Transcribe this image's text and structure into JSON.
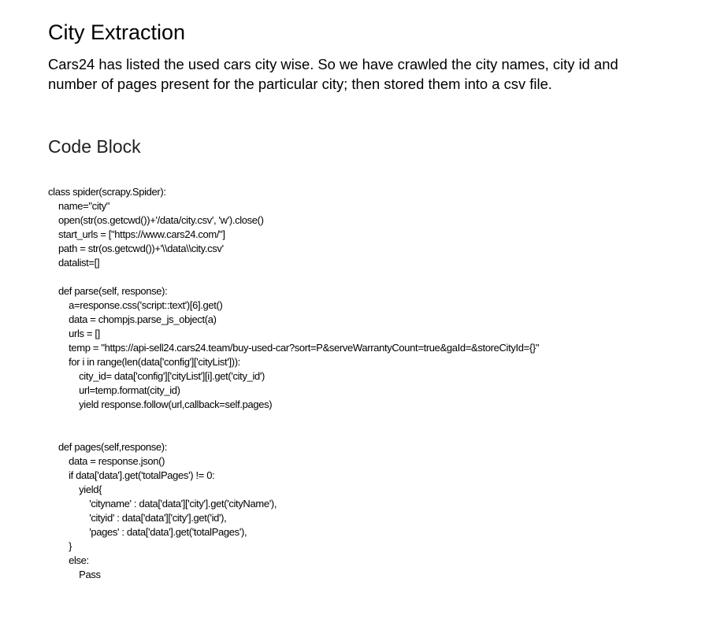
{
  "document": {
    "title": "City Extraction",
    "intro": "Cars24 has listed the used cars city wise.  So we have crawled the city names, city id and number of pages present for the particular city; then  stored them into a csv file.",
    "code_heading": "Code Block",
    "code_lines": [
      "class spider(scrapy.Spider):",
      "    name=\"city\"",
      "    open(str(os.getcwd())+'/data/city.csv', 'w').close()",
      "    start_urls = [\"https://www.cars24.com/\"]",
      "    path = str(os.getcwd())+'\\\\data\\\\city.csv'",
      "    datalist=[]",
      "",
      "    def parse(self, response):",
      "        a=response.css('script::text')[6].get()",
      "        data = chompjs.parse_js_object(a)",
      "        urls = []",
      "        temp = \"https://api-sell24.cars24.team/buy-used-car?sort=P&serveWarrantyCount=true&gaId=&storeCityId={}\"",
      "        for i in range(len(data['config']['cityList'])):",
      "            city_id= data['config']['cityList'][i].get('city_id')",
      "            url=temp.format(city_id)",
      "            yield response.follow(url,callback=self.pages)",
      "",
      "",
      "    def pages(self,response):",
      "        data = response.json()",
      "        if data['data'].get('totalPages') != 0:",
      "            yield{",
      "                'cityname' : data['data']['city'].get('cityName'),",
      "                'cityid' : data['data']['city'].get('id'),",
      "                'pages' : data['data'].get('totalPages'),",
      "        }",
      "        else:",
      "            Pass"
    ]
  }
}
